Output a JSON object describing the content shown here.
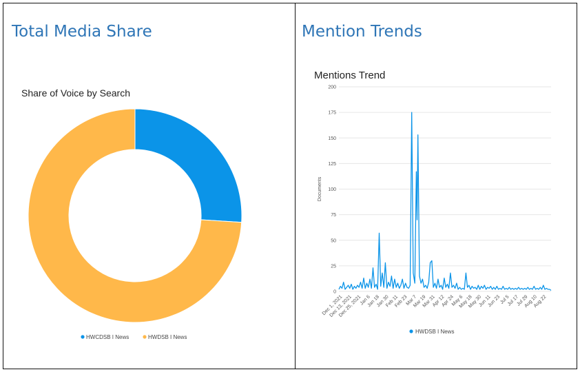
{
  "panels": {
    "left_title": "Total Media Share",
    "right_title": "Mention Trends"
  },
  "colors": {
    "blue": "#0b94e8",
    "orange": "#ffb84a",
    "title_blue": "#2e75b6",
    "grid": "#e6e6e6"
  },
  "chart_data": [
    {
      "type": "pie",
      "title": "Share of Voice by Search",
      "donut": true,
      "labels": [
        "HWCDSB I News",
        "HWDSB I News"
      ],
      "values": [
        26,
        74
      ],
      "colors": [
        "#0b94e8",
        "#ffb84a"
      ],
      "legend": "bottom"
    },
    {
      "type": "line",
      "title": "Mentions Trend",
      "ylabel": "Documents",
      "ylim": [
        0,
        200
      ],
      "yticks": [
        0,
        25,
        50,
        75,
        100,
        125,
        150,
        175,
        200
      ],
      "xlim": [
        "2021-12-01",
        "2022-09-01"
      ],
      "xticks": [
        "Dec 1, 2021",
        "Dec 13, 2021",
        "Dec 25, 2021",
        "Jan 6",
        "Jan 18",
        "Jan 30",
        "Feb 11",
        "Feb 23",
        "Mar 7",
        "Mar 19",
        "Mar 31",
        "Apr 12",
        "Apr 24",
        "May 6",
        "May 18",
        "May 30",
        "Jun 11",
        "Jun 23",
        "Jul 5",
        "Jul 17",
        "Jul 29",
        "Aug 10",
        "Aug 22"
      ],
      "legend": "bottom",
      "grid": true,
      "series": [
        {
          "name": "HWDSB I News",
          "color": "#0b94e8",
          "points": [
            [
              "2021-12-01",
              2
            ],
            [
              "2021-12-03",
              5
            ],
            [
              "2021-12-05",
              3
            ],
            [
              "2021-12-07",
              9
            ],
            [
              "2021-12-09",
              2
            ],
            [
              "2021-12-11",
              4
            ],
            [
              "2021-12-13",
              6
            ],
            [
              "2021-12-15",
              3
            ],
            [
              "2021-12-17",
              7
            ],
            [
              "2021-12-19",
              2
            ],
            [
              "2021-12-21",
              5
            ],
            [
              "2021-12-23",
              3
            ],
            [
              "2021-12-25",
              6
            ],
            [
              "2021-12-27",
              4
            ],
            [
              "2021-12-29",
              9
            ],
            [
              "2021-12-31",
              3
            ],
            [
              "2022-01-02",
              13
            ],
            [
              "2022-01-04",
              3
            ],
            [
              "2022-01-06",
              8
            ],
            [
              "2022-01-08",
              4
            ],
            [
              "2022-01-10",
              12
            ],
            [
              "2022-01-12",
              3
            ],
            [
              "2022-01-14",
              23
            ],
            [
              "2022-01-16",
              4
            ],
            [
              "2022-01-18",
              7
            ],
            [
              "2022-01-20",
              2
            ],
            [
              "2022-01-22",
              57
            ],
            [
              "2022-01-24",
              5
            ],
            [
              "2022-01-26",
              18
            ],
            [
              "2022-01-28",
              4
            ],
            [
              "2022-01-30",
              28
            ],
            [
              "2022-02-01",
              3
            ],
            [
              "2022-02-03",
              9
            ],
            [
              "2022-02-05",
              5
            ],
            [
              "2022-02-07",
              15
            ],
            [
              "2022-02-09",
              3
            ],
            [
              "2022-02-11",
              12
            ],
            [
              "2022-02-13",
              4
            ],
            [
              "2022-02-15",
              8
            ],
            [
              "2022-02-17",
              3
            ],
            [
              "2022-02-19",
              6
            ],
            [
              "2022-02-21",
              12
            ],
            [
              "2022-02-23",
              3
            ],
            [
              "2022-02-25",
              8
            ],
            [
              "2022-02-27",
              4
            ],
            [
              "2022-03-01",
              3
            ],
            [
              "2022-03-03",
              6
            ],
            [
              "2022-03-05",
              175
            ],
            [
              "2022-03-07",
              18
            ],
            [
              "2022-03-09",
              8
            ],
            [
              "2022-03-11",
              117
            ],
            [
              "2022-03-12",
              70
            ],
            [
              "2022-03-13",
              153
            ],
            [
              "2022-03-15",
              15
            ],
            [
              "2022-03-17",
              8
            ],
            [
              "2022-03-19",
              12
            ],
            [
              "2022-03-21",
              4
            ],
            [
              "2022-03-23",
              6
            ],
            [
              "2022-03-25",
              3
            ],
            [
              "2022-03-27",
              9
            ],
            [
              "2022-03-29",
              28
            ],
            [
              "2022-03-31",
              30
            ],
            [
              "2022-04-02",
              4
            ],
            [
              "2022-04-04",
              8
            ],
            [
              "2022-04-06",
              3
            ],
            [
              "2022-04-08",
              12
            ],
            [
              "2022-04-10",
              4
            ],
            [
              "2022-04-12",
              6
            ],
            [
              "2022-04-14",
              2
            ],
            [
              "2022-04-16",
              13
            ],
            [
              "2022-04-18",
              4
            ],
            [
              "2022-04-20",
              7
            ],
            [
              "2022-04-22",
              3
            ],
            [
              "2022-04-24",
              18
            ],
            [
              "2022-04-26",
              4
            ],
            [
              "2022-04-28",
              6
            ],
            [
              "2022-04-30",
              3
            ],
            [
              "2022-05-02",
              8
            ],
            [
              "2022-05-04",
              2
            ],
            [
              "2022-05-06",
              4
            ],
            [
              "2022-05-08",
              2
            ],
            [
              "2022-05-10",
              3
            ],
            [
              "2022-05-12",
              2
            ],
            [
              "2022-05-14",
              18
            ],
            [
              "2022-05-16",
              4
            ],
            [
              "2022-05-18",
              6
            ],
            [
              "2022-05-20",
              2
            ],
            [
              "2022-05-22",
              5
            ],
            [
              "2022-05-24",
              3
            ],
            [
              "2022-05-26",
              4
            ],
            [
              "2022-05-28",
              2
            ],
            [
              "2022-05-30",
              6
            ],
            [
              "2022-06-01",
              2
            ],
            [
              "2022-06-03",
              5
            ],
            [
              "2022-06-05",
              3
            ],
            [
              "2022-06-07",
              6
            ],
            [
              "2022-06-09",
              2
            ],
            [
              "2022-06-11",
              4
            ],
            [
              "2022-06-13",
              3
            ],
            [
              "2022-06-15",
              5
            ],
            [
              "2022-06-17",
              2
            ],
            [
              "2022-06-19",
              4
            ],
            [
              "2022-06-21",
              2
            ],
            [
              "2022-06-23",
              5
            ],
            [
              "2022-06-25",
              2
            ],
            [
              "2022-06-27",
              3
            ],
            [
              "2022-06-29",
              2
            ],
            [
              "2022-07-01",
              5
            ],
            [
              "2022-07-03",
              2
            ],
            [
              "2022-07-05",
              3
            ],
            [
              "2022-07-07",
              2
            ],
            [
              "2022-07-09",
              4
            ],
            [
              "2022-07-11",
              2
            ],
            [
              "2022-07-13",
              3
            ],
            [
              "2022-07-15",
              2
            ],
            [
              "2022-07-17",
              3
            ],
            [
              "2022-07-19",
              2
            ],
            [
              "2022-07-21",
              4
            ],
            [
              "2022-07-23",
              2
            ],
            [
              "2022-07-25",
              3
            ],
            [
              "2022-07-27",
              2
            ],
            [
              "2022-07-29",
              3
            ],
            [
              "2022-07-31",
              2
            ],
            [
              "2022-08-02",
              4
            ],
            [
              "2022-08-04",
              2
            ],
            [
              "2022-08-06",
              3
            ],
            [
              "2022-08-08",
              2
            ],
            [
              "2022-08-10",
              5
            ],
            [
              "2022-08-12",
              2
            ],
            [
              "2022-08-14",
              3
            ],
            [
              "2022-08-16",
              2
            ],
            [
              "2022-08-18",
              4
            ],
            [
              "2022-08-20",
              2
            ],
            [
              "2022-08-22",
              6
            ],
            [
              "2022-08-24",
              2
            ],
            [
              "2022-08-26",
              3
            ],
            [
              "2022-08-28",
              2
            ],
            [
              "2022-08-30",
              2
            ],
            [
              "2022-09-01",
              1
            ]
          ]
        }
      ]
    }
  ]
}
